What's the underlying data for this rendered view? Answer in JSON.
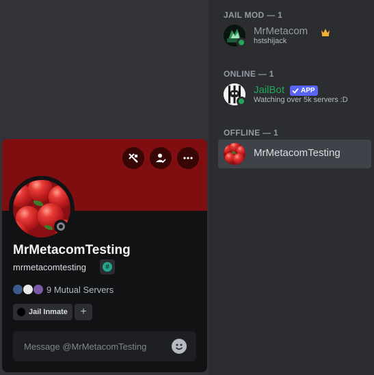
{
  "member_list": {
    "groups": [
      {
        "header": "JAIL MOD — 1",
        "members": [
          {
            "name": "MrMetacom",
            "subtext": "hstshijack",
            "name_color": "#949ba4",
            "status": "online",
            "crown_icon": "crown-icon"
          }
        ]
      },
      {
        "header": "ONLINE — 1",
        "members": [
          {
            "name": "JailBot",
            "badge": "APP",
            "subtext": "Watching over 5k servers :D",
            "name_color": "#23a55a",
            "status": "online"
          }
        ]
      },
      {
        "header": "OFFLINE — 1",
        "members": [
          {
            "name": "MrMetacomTesting",
            "name_color": "#dbdee1",
            "status": "offline",
            "highlighted": true
          }
        ]
      }
    ]
  },
  "profile": {
    "banner_color": "#7e0e0f",
    "display_name": "MrMetacomTesting",
    "username": "mrmetacomtesting",
    "badge_icon": "hashtag-badge-icon",
    "mutual_servers": "9 Mutual Servers",
    "role": "Jail Inmate",
    "add_role": "+",
    "message_placeholder": "Message @MrMetacomTesting",
    "actions": [
      "moderation-icon",
      "add-friend-icon",
      "more-options-icon"
    ]
  },
  "colors": {
    "online": "#23a55a",
    "offline": "#80848e",
    "app_badge": "#5865f2"
  }
}
